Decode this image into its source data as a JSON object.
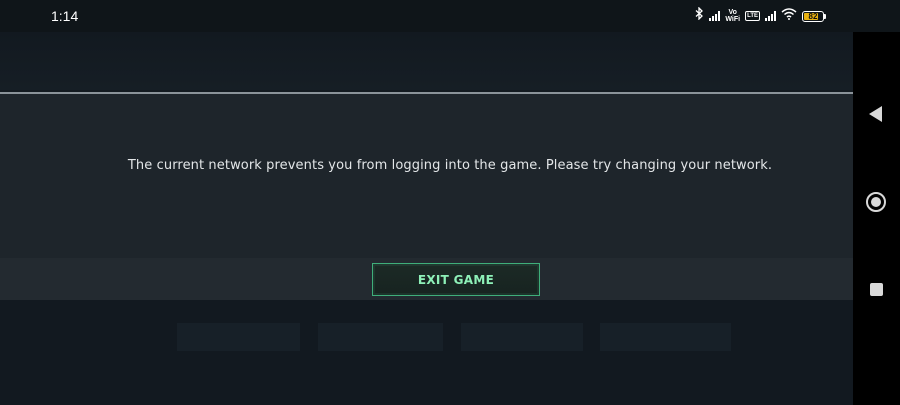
{
  "status_bar": {
    "time": "1:14",
    "vowifi_top": "Vo",
    "vowifi_bottom": "WiFi",
    "volte": "LTE",
    "battery_level": "82",
    "battery_color": "#e8b10f",
    "icons": [
      "bluetooth-icon",
      "signal-icon",
      "vowifi-icon",
      "volte-icon",
      "signal-icon",
      "wifi-icon",
      "battery-icon"
    ]
  },
  "dialog": {
    "message": "The current network prevents you from logging into the game. Please try changing your network.",
    "exit_button_label": "EXIT GAME",
    "accent_color": "#3fae7a"
  },
  "nav_bar": {
    "icons": [
      "back-icon",
      "home-icon",
      "recents-icon"
    ]
  }
}
